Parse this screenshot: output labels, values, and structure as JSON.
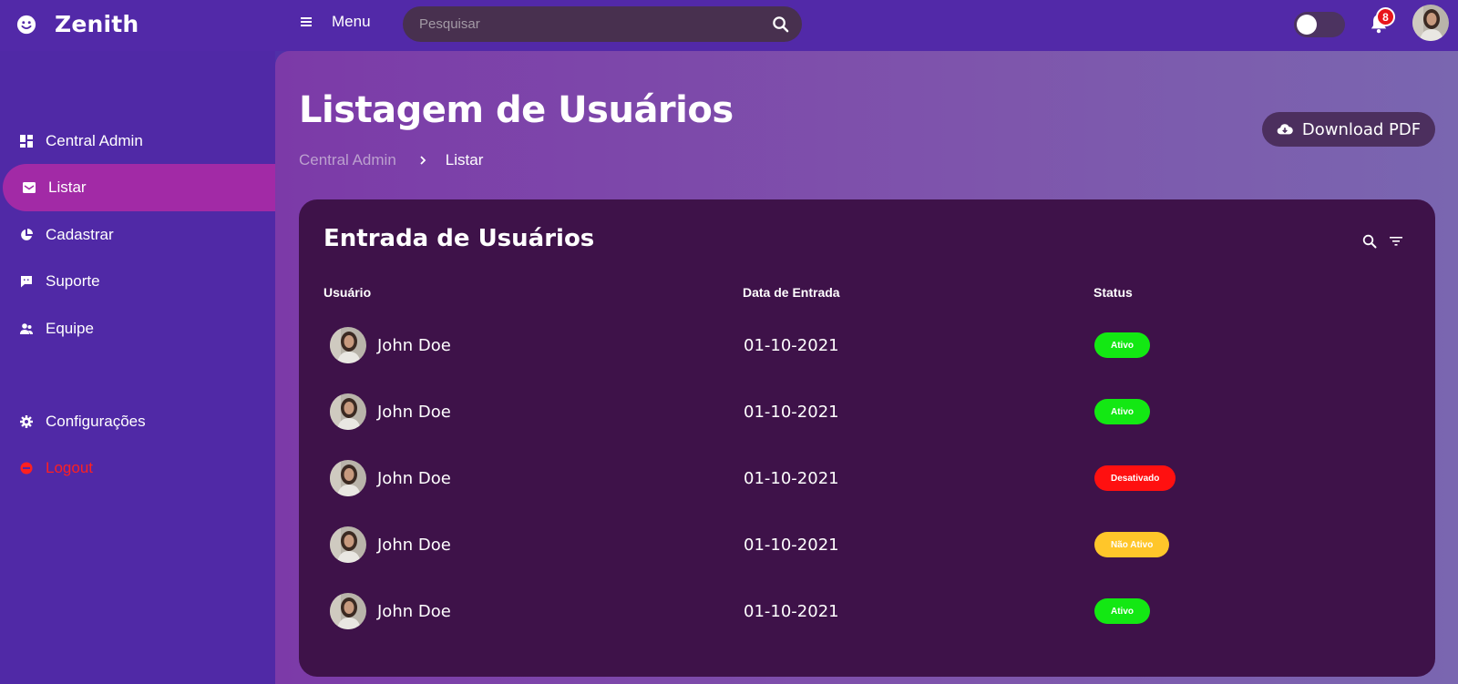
{
  "brand": {
    "name": "Zenith",
    "icon": "smile-icon"
  },
  "topbar": {
    "menu_label": "Menu",
    "search_placeholder": "Pesquisar",
    "notification_count": "8",
    "theme_toggle_on": false
  },
  "sidebar": {
    "items": [
      {
        "label": "Central Admin",
        "icon": "dashboard-icon",
        "active": false
      },
      {
        "label": "Listar",
        "icon": "inbox-icon",
        "active": true
      },
      {
        "label": "Cadastrar",
        "icon": "pie-chart-icon",
        "active": false
      },
      {
        "label": "Suporte",
        "icon": "chat-icon",
        "active": false
      },
      {
        "label": "Equipe",
        "icon": "team-icon",
        "active": false
      }
    ],
    "settings_label": "Configurações",
    "logout_label": "Logout"
  },
  "page": {
    "title": "Listagem de Usuários",
    "breadcrumb": {
      "parent": "Central Admin",
      "current": "Listar"
    },
    "download_label": "Download PDF"
  },
  "table": {
    "title": "Entrada de Usuários",
    "headers": {
      "user": "Usuário",
      "date": "Data de Entrada",
      "status": "Status"
    },
    "rows": [
      {
        "name": "John Doe",
        "date": "01-10-2021",
        "status": "Ativo"
      },
      {
        "name": "John Doe",
        "date": "01-10-2021",
        "status": "Ativo"
      },
      {
        "name": "John Doe",
        "date": "01-10-2021",
        "status": "Desativado"
      },
      {
        "name": "John Doe",
        "date": "01-10-2021",
        "status": "Não Ativo"
      },
      {
        "name": "John Doe",
        "date": "01-10-2021",
        "status": "Ativo"
      }
    ]
  },
  "colors": {
    "accent": "#a22aa6",
    "status_active": "#13e813",
    "status_disabled": "#ff1010",
    "status_inactive": "#ffc62a",
    "logout": "#ff2020"
  }
}
